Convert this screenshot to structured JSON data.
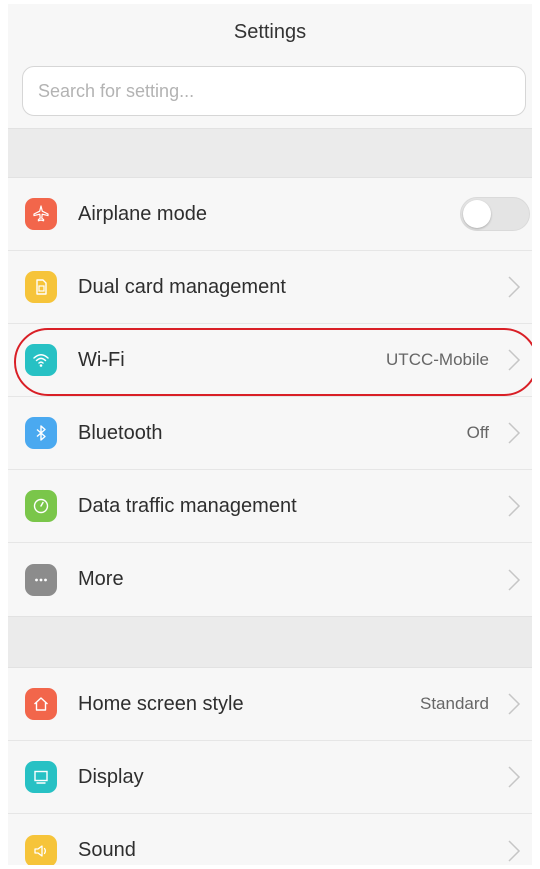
{
  "header": {
    "title": "Settings"
  },
  "search": {
    "placeholder": "Search for setting..."
  },
  "section1": [
    {
      "label": "Airplane mode",
      "icon": "airplane-icon",
      "color": "#f2664b",
      "control": "toggle",
      "toggle_on": false
    },
    {
      "label": "Dual card management",
      "icon": "sim-card-icon",
      "color": "#f6c43a",
      "control": "chevron"
    },
    {
      "label": "Wi-Fi",
      "icon": "wifi-icon",
      "color": "#27c1c4",
      "value": "UTCC-Mobile",
      "control": "chevron",
      "highlighted": true
    },
    {
      "label": "Bluetooth",
      "icon": "bluetooth-icon",
      "color": "#4aa9f0",
      "value": "Off",
      "control": "chevron"
    },
    {
      "label": "Data traffic management",
      "icon": "data-traffic-icon",
      "color": "#7ac64a",
      "control": "chevron"
    },
    {
      "label": "More",
      "icon": "more-icon",
      "color": "#8c8c8c",
      "control": "chevron"
    }
  ],
  "section2": [
    {
      "label": "Home screen style",
      "icon": "home-icon",
      "color": "#f2664b",
      "value": "Standard",
      "control": "chevron"
    },
    {
      "label": "Display",
      "icon": "display-icon",
      "color": "#27c1c4",
      "control": "chevron"
    },
    {
      "label": "Sound",
      "icon": "sound-icon",
      "color": "#f6c43a",
      "control": "chevron"
    }
  ],
  "colors": {
    "highlight_circle": "#d91f26",
    "section_gap": "#ebebeb",
    "background": "#f7f7f7"
  }
}
